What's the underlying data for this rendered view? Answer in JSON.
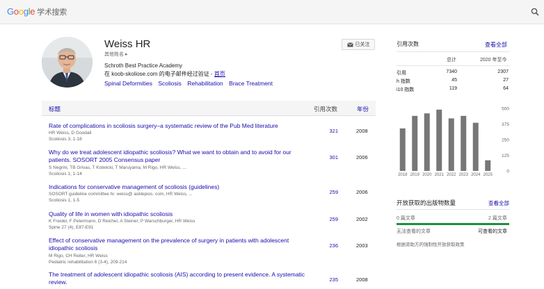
{
  "header": {
    "logo_google": "Google",
    "logo_scholar": "学术搜索",
    "search_icon": "search-icon"
  },
  "profile": {
    "name": "Weiss HR",
    "other_names": "其他姓名 ▸",
    "affiliation": "Schroth Best Practice Academy",
    "verified_prefix": "在 koob-skoliose.com 的电子邮件经过验证 - ",
    "homepage": "首页",
    "interests": [
      "Spinal Deformities",
      "Scoliosis",
      "Rehabilitation",
      "Brace Treatment"
    ],
    "follow_label": "已关注"
  },
  "table": {
    "col_title": "标题",
    "col_cited": "引用次数",
    "col_year": "年份",
    "rows": [
      {
        "title": "Rate of complications in scoliosis surgery–a systematic review of the Pub Med literature",
        "authors": "HR Weiss, D Goodall",
        "venue": "Scoliosis 3, 1-18",
        "cited": "321",
        "year": "2008"
      },
      {
        "title": "Why do we treat adolescent idiopathic scoliosis? What we want to obtain and to avoid for our patients. SOSORT 2005 Consensus paper",
        "authors": "S Negrini, TB Grivas, T Kotwicki, T Maruyama, M Rigo, HR Weiss, ...",
        "venue": "Scoliosis 1, 1-14",
        "cited": "301",
        "year": "2006"
      },
      {
        "title": "Indications for conservative management of scoliosis (guidelines)",
        "authors": "SOSORT guideline committee hr. weiss@ asklepios. com, HR Weiss, ...",
        "venue": "Scoliosis 1, 1-5",
        "cited": "259",
        "year": "2006"
      },
      {
        "title": "Quality of life in women with idiopathic scoliosis",
        "authors": "K Freidel, F Petermann, D Reichel, A Steiner, P Warschburger, HR Weiss",
        "venue": "Spine 27 (4), E87-E91",
        "cited": "259",
        "year": "2002"
      },
      {
        "title": "Effect of conservative management on the prevalence of surgery in patients with adolescent idiopathic scoliosis",
        "authors": "M Rigo, CH Reiter, HR Weiss",
        "venue": "Pediatric rehabilitation 6 (3-4), 209-214",
        "cited": "236",
        "year": "2003"
      },
      {
        "title": "The treatment of adolescent idiopathic scoliosis (AIS) according to present evidence. A systematic review.",
        "authors": "",
        "venue": "",
        "cited": "235",
        "year": "2008"
      }
    ]
  },
  "citations": {
    "title": "引用次数",
    "view_all": "查看全部",
    "col_total": "总计",
    "col_since": "2020 年至今",
    "rows": [
      {
        "label": "引用",
        "total": "7340",
        "since": "2307"
      },
      {
        "label": "h 指数",
        "total": "45",
        "since": "27"
      },
      {
        "label": "i10 指数",
        "total": "119",
        "since": "64"
      }
    ]
  },
  "chart_data": {
    "type": "bar",
    "categories": [
      "2018",
      "2019",
      "2020",
      "2021",
      "2022",
      "2023",
      "2024",
      "2025"
    ],
    "values": [
      340,
      440,
      460,
      490,
      420,
      440,
      385,
      85
    ],
    "ylim": [
      0,
      500
    ],
    "yticks": [
      "500",
      "375",
      "250",
      "125",
      "0"
    ],
    "bar_color": "#777777"
  },
  "open_access": {
    "title": "开放获取的出版物数量",
    "view_all": "查看全部",
    "not_available": "0 篇文章",
    "available": "2 篇文章",
    "not_available_label": "无法查看的文章",
    "available_label": "可查看的文章",
    "note": "根据资助方的强制性开放获取政策",
    "bar_color": "#1e8e3e"
  }
}
